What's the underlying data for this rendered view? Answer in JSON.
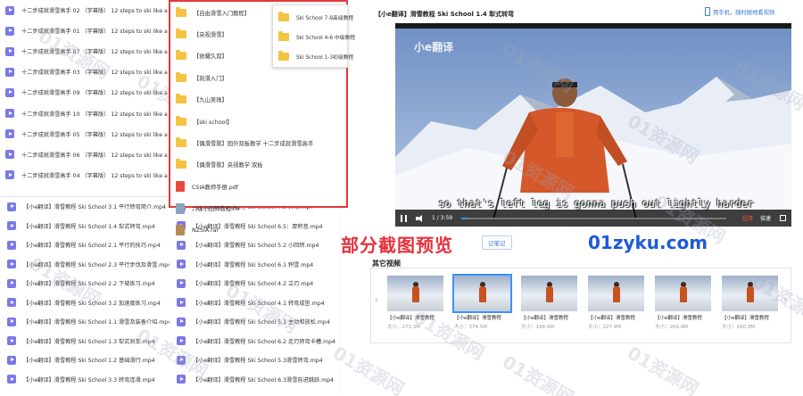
{
  "top_files": [
    "十二步成就滑雪高手 02 （字幕版） 12 steps to ski like a pro.flv",
    "十二步成就滑雪高手 01 （字幕版） 12 steps to ski like a pro.flv",
    "十二步成就滑雪高手 07 （字幕版） 12 steps to ski like a pro.flv",
    "十二步成就滑雪高手 03 （字幕版） 12 steps to ski like a pro.flv",
    "十二步成就滑雪高手 09 （字幕版） 12 steps to ski like a pro.flv",
    "十二步成就滑雪高手 10 （字幕版） 12 steps to ski like a pro.flv",
    "十二步成就滑雪高手 05 （字幕版） 12 steps to ski like a pro.flv",
    "十二步成就滑雪高手 06 （字幕版） 12 steps to ski like a pro.flv",
    "十二步成就滑雪高手 04 （字幕版） 12 steps to ski like a pro.flv"
  ],
  "bottom_left": [
    "【小e翻译】滑雪教程 Ski School 3.1 平行转弯简介.mp4",
    "【小e翻译】滑雪教程 Ski School 1.4 犁式转弯.mp4",
    "【小e翻译】滑雪教程 Ski School 2.1 平行的技巧.mp4",
    "【小e翻译】滑雪教程 Ski School 2.3 平行步伐及滑雪.mp4",
    "【小e翻译】滑雪教程 Ski School 2.2 下坡练习.mp4",
    "【小e翻译】滑雪教程 Ski School 3.2 加速度练习.mp4",
    "【小e翻译】滑雪教程 Ski School 1.1 滑雪及装备介绍.mp4",
    "【小e翻译】滑雪教程 Ski School 1.3 犁式刹车.mp4",
    "【小e翻译】滑雪教程 Ski School 1.2 基础滑行.mp4",
    "【小e翻译】滑雪教程 Ski School 3.3 转弯连滑.mp4"
  ],
  "bottom_right": [
    "【小e翻译】滑雪教程 Ski School 4.3 转弯.mp4",
    "【小e翻译】滑雪教程 Ski School 6.5：厚积音.mp4",
    "【小e翻译】滑雪教程 Ski School 5.2 小回转.mp4",
    "【小e翻译】滑雪教程 Ski School 6.1 积雪.mp4",
    "【小e翻译】滑雪教程 Ski School 4.2 立刃.mp4",
    "【小e翻译】滑雪教程 Ski School 4.1 转弯成型.mp4",
    "【小e翻译】滑雪教程 Ski School 5.1 主动和放松.mp4",
    "【小e翻译】滑雪教程 Ski School 6.2 走刃转弯卡槽.mp4",
    "【小e翻译】滑雪教程 Ski School 5.3滑雪转弯.mp4",
    "【小e翻译】滑雪教程 Ski School 6.3滑雪前进跳跃.mp4"
  ],
  "folders": [
    {
      "label": "【自由滑雪入门教程】",
      "type": "folder"
    },
    {
      "label": "【央视滑雪】",
      "type": "folder"
    },
    {
      "label": "【依耀久双】",
      "type": "folder"
    },
    {
      "label": "【刻滑入门】",
      "type": "folder"
    },
    {
      "label": "【九山美珠】",
      "type": "folder"
    },
    {
      "label": "【ski school】",
      "type": "folder"
    },
    {
      "label": "【偶滑雪歌】国外双板教学 十二步成就滑雪高手",
      "type": "folder"
    },
    {
      "label": "【偶滑雪歌】央视教学 双板",
      "type": "folder"
    },
    {
      "label": "CSIA教师手册.pdf",
      "type": "pdf"
    },
    {
      "label": "六级小回转教程.flv",
      "type": "doc"
    },
    {
      "label": "NZSIA.rar",
      "type": "rar"
    }
  ],
  "submenu": [
    "Ski School 7-9高级教程",
    "Ski School 4-6 中级教程",
    "Ski School 1-3初级教程"
  ],
  "video": {
    "title": "【小e翻译】滑雪教程 Ski School 1.4 犁式转弯",
    "mobile_link": "用手机，随时随地看视频",
    "logo_text": "小e翻译",
    "subtitle": "so that's left leg is gonna push out lightly harder",
    "time": "1 / 3:59",
    "progress": 0.02,
    "ctl_quality": "超清",
    "ctl_speed": "倍速"
  },
  "overlay": {
    "label": "部分截图预览",
    "site": "01zyku.com"
  },
  "note_button": "记笔记",
  "other_videos_title": "其它视频",
  "thumbs": [
    {
      "caption": "【小e翻译】滑雪教程",
      "size": "大小：271.3M"
    },
    {
      "caption": "【小e翻译】滑雪教程",
      "size": "大小：374.5M"
    },
    {
      "caption": "【小e翻译】滑雪教程",
      "size": "大小：198.6M"
    },
    {
      "caption": "【小e翻译】滑雪教程",
      "size": "大小：227.9M"
    },
    {
      "caption": "【小e翻译】滑雪教程",
      "size": "大小：269.9M"
    },
    {
      "caption": "【小e翻译】滑雪教程",
      "size": "大小：160.3M"
    }
  ],
  "watermark": "01资源网",
  "colors": {
    "folder_border": "#e03a3a",
    "accent": "#3a92ff",
    "overlay_red": "#e8303a",
    "overlay_blue": "#1d5bd6"
  }
}
